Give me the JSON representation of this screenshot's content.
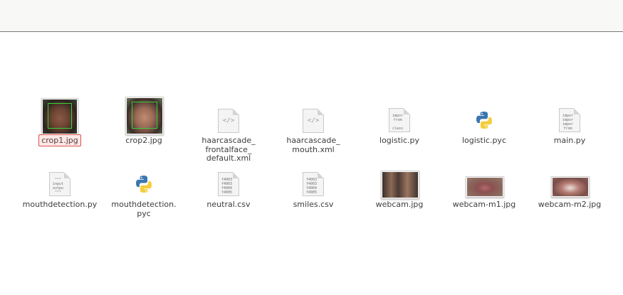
{
  "files": [
    {
      "name": "crop1.jpg",
      "kind": "photo",
      "icon": "photo-thumbnail",
      "selected": true
    },
    {
      "name": "crop2.jpg",
      "kind": "photo",
      "icon": "photo-thumbnail"
    },
    {
      "name": "haarcascade_\nfrontalface_\ndefault.xml",
      "kind": "xml",
      "icon": "code-file-icon",
      "glyph": "</>"
    },
    {
      "name": "haarcascade_\nmouth.xml",
      "kind": "xml",
      "icon": "code-file-icon",
      "glyph": "</>"
    },
    {
      "name": "logistic.py",
      "kind": "text",
      "icon": "python-script-icon",
      "preview": "impor\nfrom\n\nclass"
    },
    {
      "name": "logistic.pyc",
      "kind": "pyc",
      "icon": "python-logo-icon"
    },
    {
      "name": "main.py",
      "kind": "text",
      "icon": "python-script-icon",
      "preview": "impor\nimpor\nimpor\nfrom"
    },
    {
      "name": "mouthdetection.py",
      "kind": "text",
      "icon": "python-script-icon",
      "preview": "\"\"\"\ninput\noutpu\n\"\"\""
    },
    {
      "name": "mouthdetection.\npyc",
      "kind": "pyc",
      "icon": "python-logo-icon"
    },
    {
      "name": "neutral.csv",
      "kind": "text",
      "icon": "csv-file-icon",
      "preview": "f4003\nf4003\nf4004\nf4005"
    },
    {
      "name": "smiles.csv",
      "kind": "text",
      "icon": "csv-file-icon",
      "preview": "f4003\nf4003\nf4004\nf4005"
    },
    {
      "name": "webcam.jpg",
      "kind": "photo",
      "icon": "photo-thumbnail"
    },
    {
      "name": "webcam-m1.jpg",
      "kind": "photo",
      "icon": "photo-thumbnail"
    },
    {
      "name": "webcam-m2.jpg",
      "kind": "photo",
      "icon": "photo-thumbnail"
    }
  ],
  "colors": {
    "python_blue": "#3a75b0",
    "python_yellow": "#f4ce3c",
    "selection_border": "#d9534f"
  }
}
